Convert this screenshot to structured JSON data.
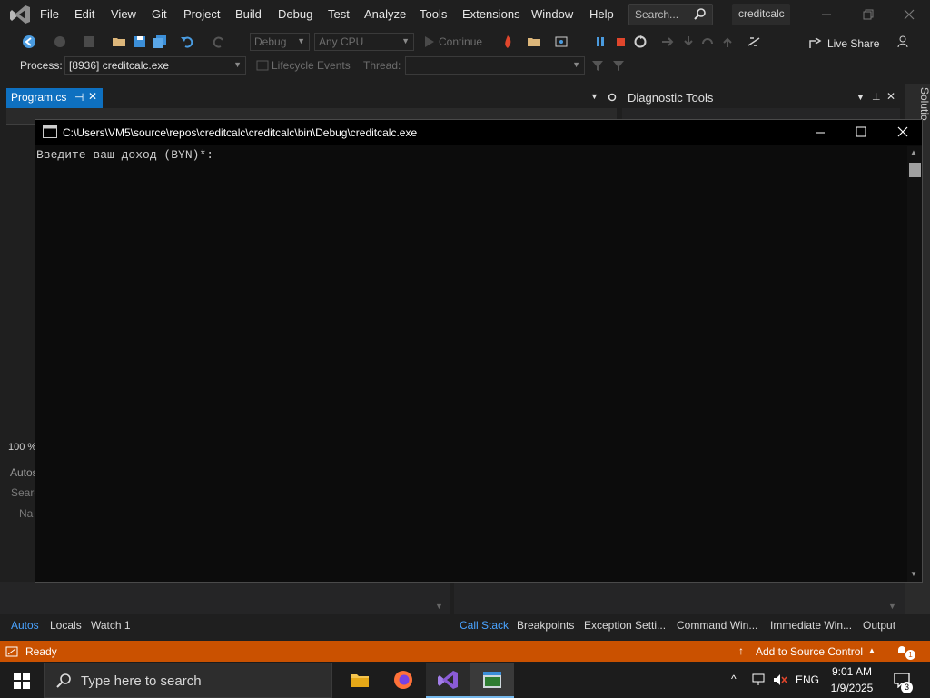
{
  "menu": [
    "File",
    "Edit",
    "View",
    "Git",
    "Project",
    "Build",
    "Debug",
    "Test",
    "Analyze",
    "Tools",
    "Extensions",
    "Window",
    "Help"
  ],
  "search": {
    "placeholder": "Search..."
  },
  "solution_name": "creditcalc",
  "toolbar": {
    "config": "Debug",
    "platform": "Any CPU",
    "continue": "Continue",
    "live_share": "Live Share"
  },
  "toolbar2": {
    "process_label": "Process:",
    "process_value": "[8936] creditcalc.exe",
    "lifecycle": "Lifecycle Events",
    "thread": "Thread:"
  },
  "tabs": {
    "program": "Program.cs"
  },
  "diag": {
    "title": "Diagnostic Tools"
  },
  "right_vertical": "Solutio",
  "zoom": "100 %",
  "autos": {
    "header": "Autos",
    "search": "Searc",
    "name": "Na"
  },
  "bottom_tabs_left": [
    "Autos",
    "Locals",
    "Watch 1"
  ],
  "bottom_tabs_right": [
    "Call Stack",
    "Breakpoints",
    "Exception Setti...",
    "Command Win...",
    "Immediate Win...",
    "Output"
  ],
  "status": {
    "ready": "Ready",
    "source_control": "Add to Source Control",
    "notifications": "1"
  },
  "console": {
    "title": "C:\\Users\\VM5\\source\\repos\\creditcalc\\creditcalc\\bin\\Debug\\creditcalc.exe",
    "text": "Введите ваш доход (BYN)*:"
  },
  "taskbar": {
    "search_placeholder": "Type here to search",
    "lang": "ENG",
    "time": "9:01 AM",
    "date": "1/9/2025",
    "notif_count": "3"
  },
  "colors": {
    "accent": "#0e70c0",
    "status": "#ca5100",
    "vs_purple": "#8a5bd6"
  }
}
